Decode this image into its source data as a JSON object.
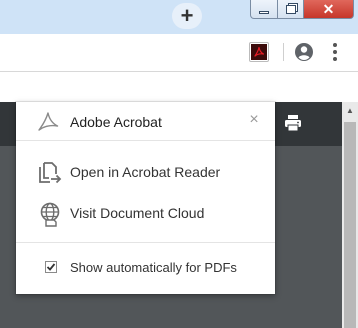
{
  "window": {
    "new_tab_glyph": "+",
    "close_glyph": "✕"
  },
  "toolbar": {
    "extension_icon": "adobe-acrobat-icon",
    "profile_icon": "account-circle-icon",
    "menu_icon": "more-vertical-icon"
  },
  "popup": {
    "title": "Adobe Acrobat",
    "close_glyph": "×",
    "items": [
      {
        "label": "Open in Acrobat Reader",
        "icon": "open-in-reader-icon"
      },
      {
        "label": "Visit Document Cloud",
        "icon": "document-cloud-icon"
      }
    ],
    "checkbox": {
      "label": "Show automatically for PDFs",
      "checked": true
    }
  },
  "colors": {
    "tabstrip": "#cfe3f7",
    "pdf_toolbar": "#323639",
    "pdf_background": "#525659",
    "acrobat_red": "#e51b24"
  }
}
